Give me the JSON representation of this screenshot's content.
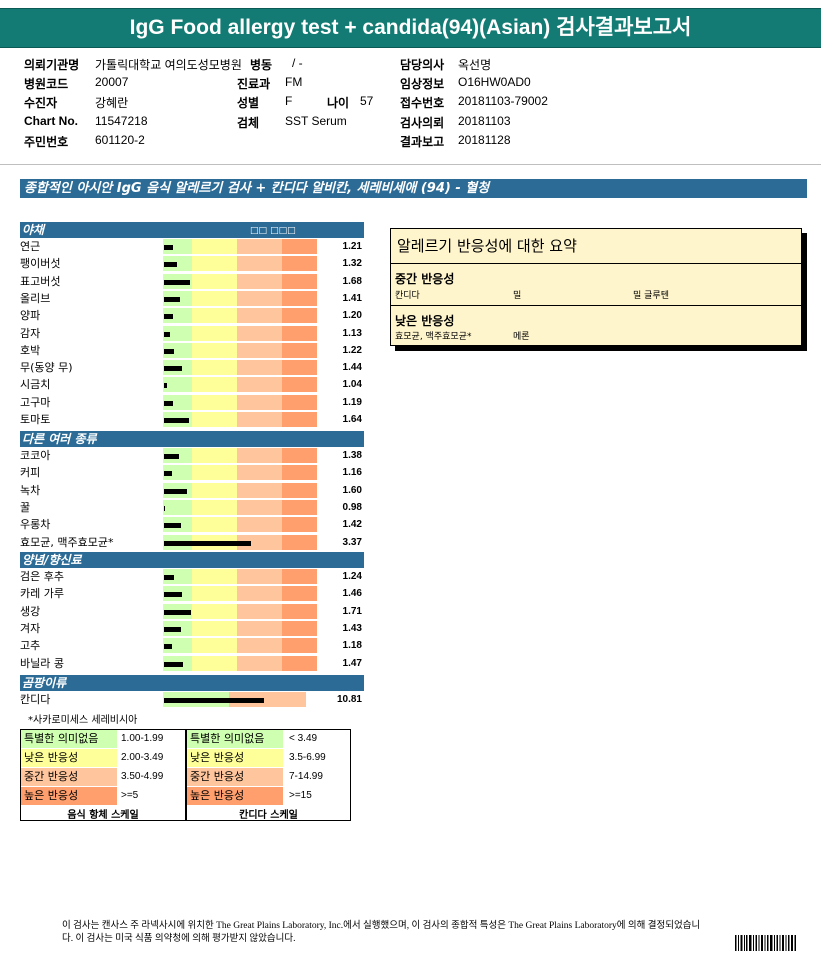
{
  "title": "IgG Food allergy test + candida(94)(Asian) 검사결과보고서",
  "info": {
    "hospital_label": "의뢰기관명",
    "hospital_value": "가톨릭대학교 여의도성모병원",
    "ward_label": "병동",
    "ward_value": "/ -",
    "doctor_label": "담당의사",
    "doctor_value": "옥선명",
    "code_label": "병원코드",
    "code_value": "20007",
    "dept_label": "진료과",
    "dept_value": "FM",
    "clinical_label": "임상정보",
    "clinical_value": "O16HW0AD0",
    "patient_label": "수진자",
    "patient_value": "강혜란",
    "sex_label": "성별",
    "sex_value": "F",
    "age_label": "나이",
    "age_value": "57",
    "receipt_label": "접수번호",
    "receipt_value": "20181103-79002",
    "chart_label": "Chart No.",
    "chart_value": "11547218",
    "specimen_label": "검체",
    "specimen_value": "SST Serum",
    "request_label": "검사의뢰",
    "request_value": "20181103",
    "id_label": "주민번호",
    "id_value": "601120-2",
    "report_label": "결과보고",
    "report_value": "20181128"
  },
  "banner": "종합적인 아시안 IgG 음식 알레르기 검사 + 칸디다 알비칸, 세레비세애 (94) - 혈청",
  "scale_header": "□□ □□□",
  "colors": {
    "header_blue": "#2b6b96",
    "teal": "#137b73",
    "green": "#cfffb0",
    "yellow": "#ffff99",
    "orange_light": "#ffc59c",
    "orange": "#ff9f6e"
  },
  "categories": [
    {
      "name": "야채",
      "items": [
        {
          "label": "연근",
          "value": "1.21",
          "level": 1.21
        },
        {
          "label": "팽이버섯",
          "value": "1.32",
          "level": 1.32
        },
        {
          "label": "표고버섯",
          "value": "1.68",
          "level": 1.68
        },
        {
          "label": "올리브",
          "value": "1.41",
          "level": 1.41
        },
        {
          "label": "양파",
          "value": "1.20",
          "level": 1.2
        },
        {
          "label": "감자",
          "value": "1.13",
          "level": 1.13
        },
        {
          "label": "호박",
          "value": "1.22",
          "level": 1.22
        },
        {
          "label": "무(동양 무)",
          "value": "1.44",
          "level": 1.44
        },
        {
          "label": "시금치",
          "value": "1.04",
          "level": 1.04
        },
        {
          "label": "고구마",
          "value": "1.19",
          "level": 1.19
        },
        {
          "label": "토마토",
          "value": "1.64",
          "level": 1.64
        }
      ]
    },
    {
      "name": "다른 여러 종류",
      "items": [
        {
          "label": "코코아",
          "value": "1.38",
          "level": 1.38
        },
        {
          "label": "커피",
          "value": "1.16",
          "level": 1.16
        },
        {
          "label": "녹차",
          "value": "1.60",
          "level": 1.6
        },
        {
          "label": "꿀",
          "value": "0.98",
          "level": 0.98
        },
        {
          "label": "우롱차",
          "value": "1.42",
          "level": 1.42
        },
        {
          "label": "효모균, 맥주효모균*",
          "value": "3.37",
          "level": 3.37
        }
      ]
    },
    {
      "name": "양념/향신료",
      "items": [
        {
          "label": "검은 후추",
          "value": "1.24",
          "level": 1.24
        },
        {
          "label": "카레 가루",
          "value": "1.46",
          "level": 1.46
        },
        {
          "label": "생강",
          "value": "1.71",
          "level": 1.71
        },
        {
          "label": "겨자",
          "value": "1.43",
          "level": 1.43
        },
        {
          "label": "고추",
          "value": "1.18",
          "level": 1.18
        },
        {
          "label": "바닐라 콩",
          "value": "1.47",
          "level": 1.47
        }
      ]
    },
    {
      "name": "곰팡이류",
      "items": [
        {
          "label": "칸디다",
          "value": "10.81",
          "level": 10.81,
          "candida": true
        }
      ]
    }
  ],
  "footnote": "*사카로미세스 세레비시아",
  "summary": {
    "title": "알레르기 반응성에 대한 요약",
    "moderate_heading": "중간 반응성",
    "moderate_items": [
      "칸디다",
      "밀",
      "밀 글루텐"
    ],
    "low_heading": "낮은 반응성",
    "low_items": [
      "효모균, 맥주효모균*",
      "메론"
    ]
  },
  "legend_food": {
    "rows": [
      {
        "label": "특별한 의미없음",
        "range": "1.00-1.99"
      },
      {
        "label": "낮은 반응성",
        "range": "2.00-3.49"
      },
      {
        "label": "중간 반응성",
        "range": "3.50-4.99"
      },
      {
        "label": "높은 반응성",
        "range": ">=5"
      }
    ],
    "caption": "음식 항체 스케일"
  },
  "legend_candida": {
    "rows": [
      {
        "label": "특별한 의미없음",
        "range": "< 3.49"
      },
      {
        "label": "낮은 반응성",
        "range": "3.5-6.99"
      },
      {
        "label": "중간 반응성",
        "range": "7-14.99"
      },
      {
        "label": "높은 반응성",
        "range": ">=15"
      }
    ],
    "caption": "칸디다 스케일"
  },
  "disclaimer": "이 검사는 캔사스 주 라넥사시에 위치한 The Great Plains Laboratory, Inc.에서 실행했으며, 이 검사의 종합적 특성은 The Great Plains Laboratory에 의해 결정되었습니다. 이 검사는 미국 식품 의약청에 의해 평가받지 않았습니다."
}
